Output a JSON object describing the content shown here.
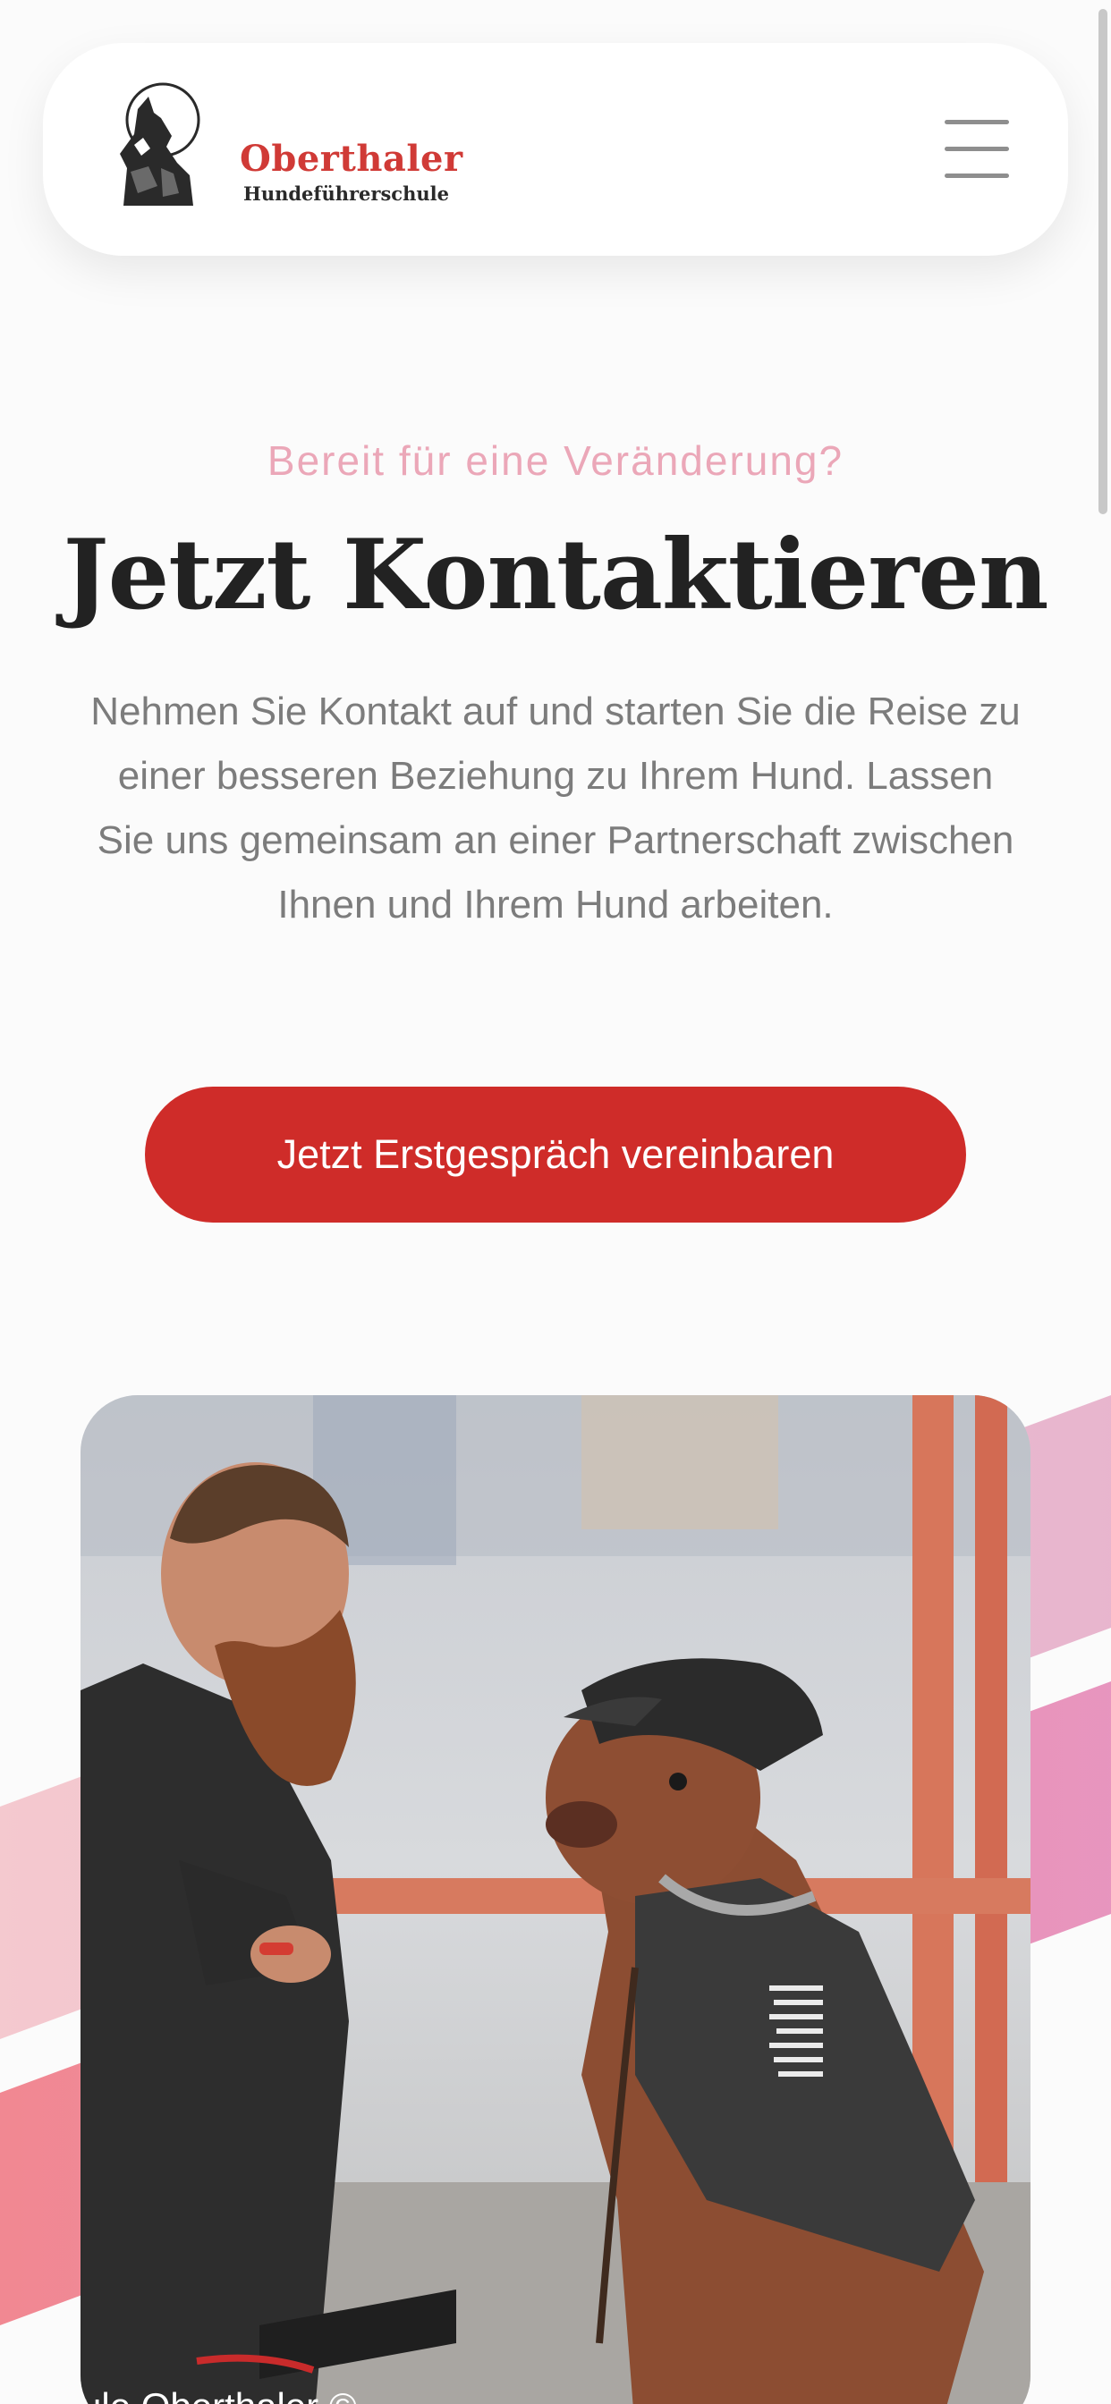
{
  "header": {
    "logo_name": "Oberthaler",
    "logo_subtitle": "Hundeführerschule",
    "menu_icon": "hamburger-menu-icon"
  },
  "hero": {
    "eyebrow": "Bereit für eine Veränderung?",
    "title": "Jetzt Kontaktieren",
    "intro": "Nehmen Sie Kontakt auf und starten Sie die Reise zu einer besseren Beziehung zu Ihrem Hund. Lassen Sie uns gemeinsam an einer Partnerschaft zwischen Ihnen und Ihrem Hund arbeiten.",
    "cta_label": "Jetzt Erstgespräch vereinbaren"
  },
  "photo": {
    "caption": "ule Oberthaler ©"
  },
  "colors": {
    "brand_red": "#cf2c29",
    "eyebrow_pink": "#eba7b8",
    "title": "#222222",
    "body_text": "#7c7c7c"
  }
}
